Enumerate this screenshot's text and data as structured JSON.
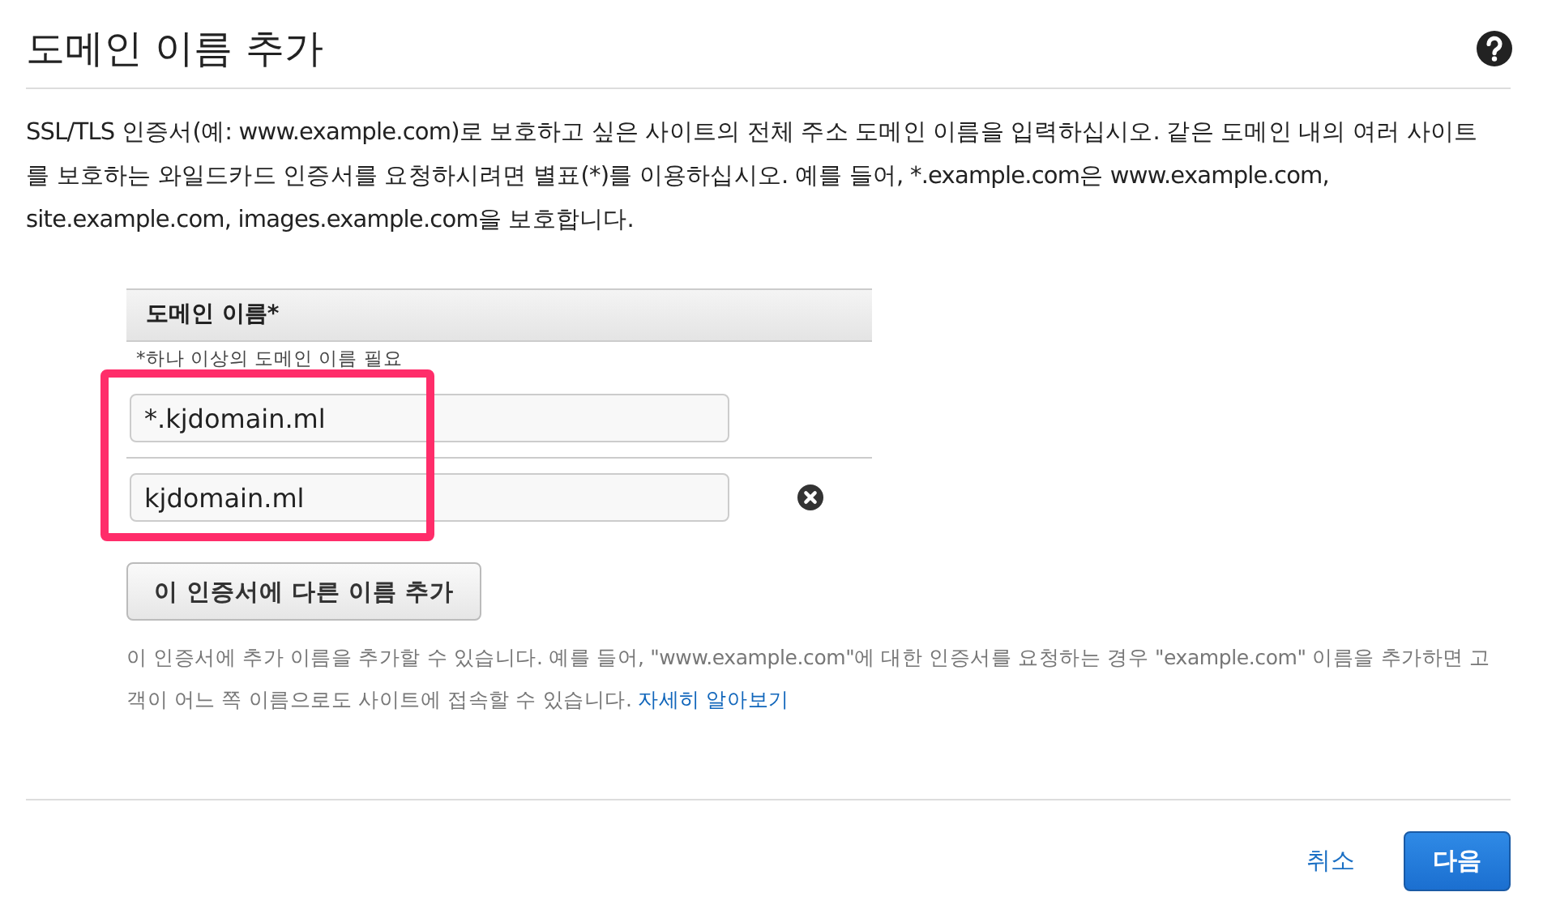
{
  "title": "도메인 이름 추가",
  "description": "SSL/TLS 인증서(예: www.example.com)로 보호하고 싶은 사이트의 전체 주소 도메인 이름을 입력하십시오. 같은 도메인 내의 여러 사이트를 보호하는 와일드카드 인증서를 요청하시려면 별표(*)를 이용하십시오. 예를 들어, *.example.com은 www.example.com, site.example.com, images.example.com을 보호합니다.",
  "table": {
    "header": "도메인 이름*",
    "hint": "*하나 이상의 도메인 이름 필요",
    "rows": [
      {
        "value": "*.kjdomain.ml",
        "removable": false
      },
      {
        "value": "kjdomain.ml",
        "removable": true
      }
    ]
  },
  "add_button": "이 인증서에 다른 이름 추가",
  "help_text": "이 인증서에 추가 이름을 추가할 수 있습니다. 예를 들어, \"www.example.com\"에 대한 인증서를 요청하는 경우 \"example.com\" 이름을 추가하면 고객이 어느 쪽 이름으로도 사이트에 접속할 수 있습니다.",
  "help_link": "자세히 알아보기",
  "cancel": "취소",
  "next": "다음"
}
